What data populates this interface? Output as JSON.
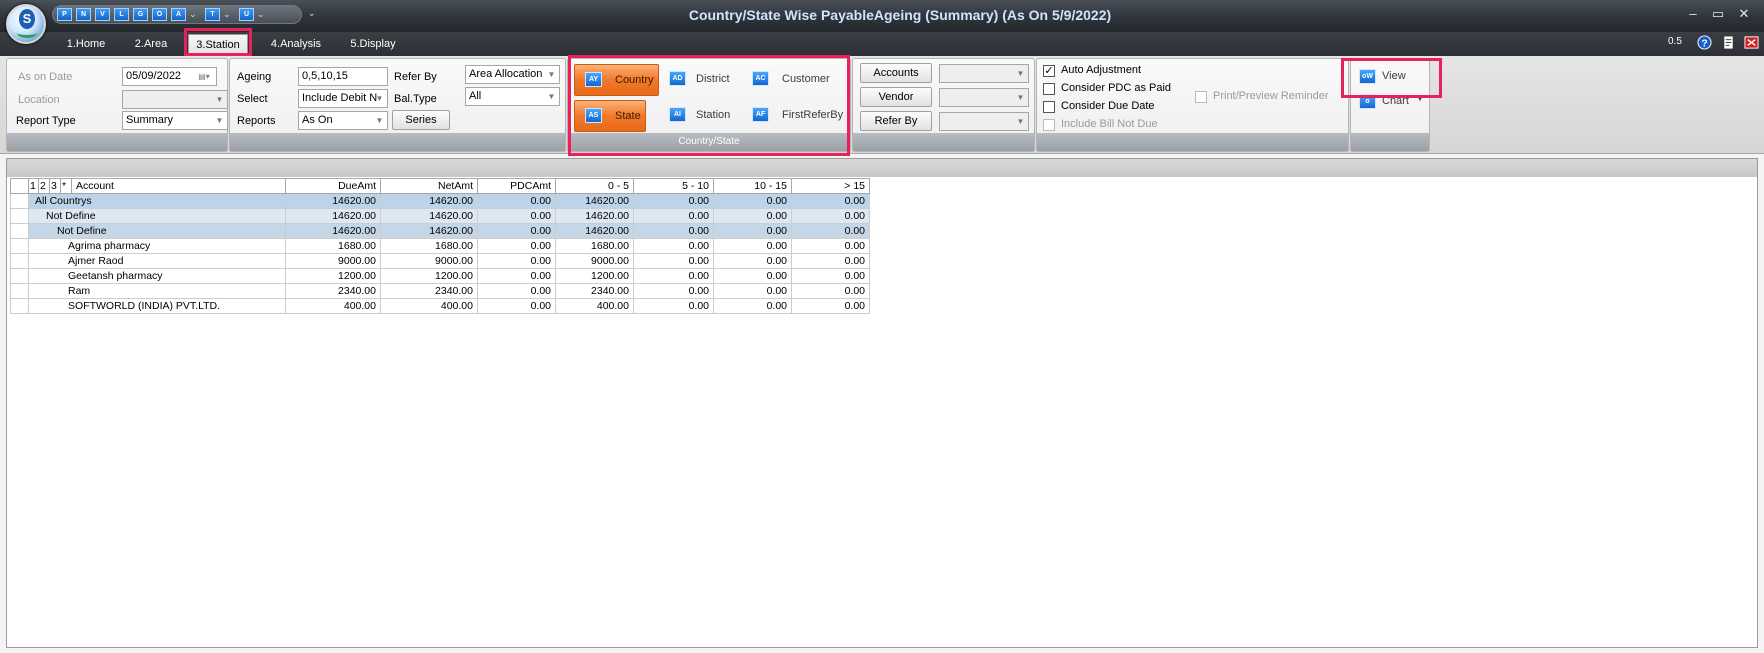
{
  "window": {
    "title": "Country/State Wise PayableAgeing (Summary) (As On 5/9/2022)",
    "controls": [
      "–",
      "▭",
      "✕"
    ]
  },
  "quick_access": [
    "P",
    "N",
    "V",
    "L",
    "G",
    "O",
    "A",
    "T",
    "U"
  ],
  "tabs": [
    {
      "label": "1.Home"
    },
    {
      "label": "2.Area"
    },
    {
      "label": "3.Station"
    },
    {
      "label": "4.Analysis"
    },
    {
      "label": "5.Display"
    }
  ],
  "zoom": "0.5",
  "filters": {
    "as_on_date_label": "As on Date",
    "as_on_date_value": "05/09/2022",
    "location_label": "Location",
    "location_value": "",
    "report_type_label": "Report Type",
    "report_type_value": "Summary"
  },
  "ageing": {
    "ageing_label": "Ageing",
    "ageing_value": "0,5,10,15",
    "select_label": "Select",
    "select_value": "Include Debit N",
    "reports_label": "Reports",
    "reports_value": "As On",
    "refer_by_label": "Refer By",
    "refer_by_value": "Area Allocation",
    "bal_type_label": "Bal.Type",
    "bal_type_value": "All",
    "series_label": "Series"
  },
  "group_by": {
    "footer": "Country/State",
    "buttons": [
      {
        "label": "Country",
        "icon": "AY"
      },
      {
        "label": "District",
        "icon": "AD"
      },
      {
        "label": "Customer",
        "icon": "AC"
      },
      {
        "label": "State",
        "icon": "AS"
      },
      {
        "label": "Station",
        "icon": "AI"
      },
      {
        "label": "FirstReferBy",
        "icon": "AF"
      }
    ]
  },
  "accounts_group": {
    "accounts_label": "Accounts",
    "vendor_label": "Vendor",
    "refer_by_label": "Refer By"
  },
  "options": {
    "auto_adjustment": "Auto Adjustment",
    "consider_pdc": "Consider PDC as Paid",
    "consider_due_date": "Consider Due Date",
    "include_bill_not_due": "Include Bill Not Due",
    "print_preview_reminder": "Print/Preview Reminder",
    "check_mark": "✓"
  },
  "actions": {
    "view_label": "View",
    "chart_label": "Chart"
  },
  "grid": {
    "levels": [
      "1",
      "2",
      "3",
      "*"
    ],
    "columns": [
      "Account",
      "DueAmt",
      "NetAmt",
      "PDCAmt",
      "0 - 5",
      "5 - 10",
      "10 - 15",
      "> 15"
    ],
    "rows": [
      {
        "account": "All Countrys",
        "due": "14620.00",
        "net": "14620.00",
        "pdc": "0.00",
        "a": "14620.00",
        "b": "0.00",
        "c": "0.00",
        "d": "0.00"
      },
      {
        "account": "Not Define",
        "due": "14620.00",
        "net": "14620.00",
        "pdc": "0.00",
        "a": "14620.00",
        "b": "0.00",
        "c": "0.00",
        "d": "0.00"
      },
      {
        "account": "Not Define",
        "due": "14620.00",
        "net": "14620.00",
        "pdc": "0.00",
        "a": "14620.00",
        "b": "0.00",
        "c": "0.00",
        "d": "0.00"
      },
      {
        "account": "Agrima pharmacy",
        "due": "1680.00",
        "net": "1680.00",
        "pdc": "0.00",
        "a": "1680.00",
        "b": "0.00",
        "c": "0.00",
        "d": "0.00"
      },
      {
        "account": "Ajmer Raod",
        "due": "9000.00",
        "net": "9000.00",
        "pdc": "0.00",
        "a": "9000.00",
        "b": "0.00",
        "c": "0.00",
        "d": "0.00"
      },
      {
        "account": "Geetansh pharmacy",
        "due": "1200.00",
        "net": "1200.00",
        "pdc": "0.00",
        "a": "1200.00",
        "b": "0.00",
        "c": "0.00",
        "d": "0.00"
      },
      {
        "account": "Ram",
        "due": "2340.00",
        "net": "2340.00",
        "pdc": "0.00",
        "a": "2340.00",
        "b": "0.00",
        "c": "0.00",
        "d": "0.00"
      },
      {
        "account": "SOFTWORLD (INDIA) PVT.LTD.",
        "due": "400.00",
        "net": "400.00",
        "pdc": "0.00",
        "a": "400.00",
        "b": "0.00",
        "c": "0.00",
        "d": "0.00"
      }
    ]
  },
  "colors": {
    "highlight": "#e8215a",
    "active_group_button": "#f3782a",
    "title_text": "#cfe4ff"
  }
}
